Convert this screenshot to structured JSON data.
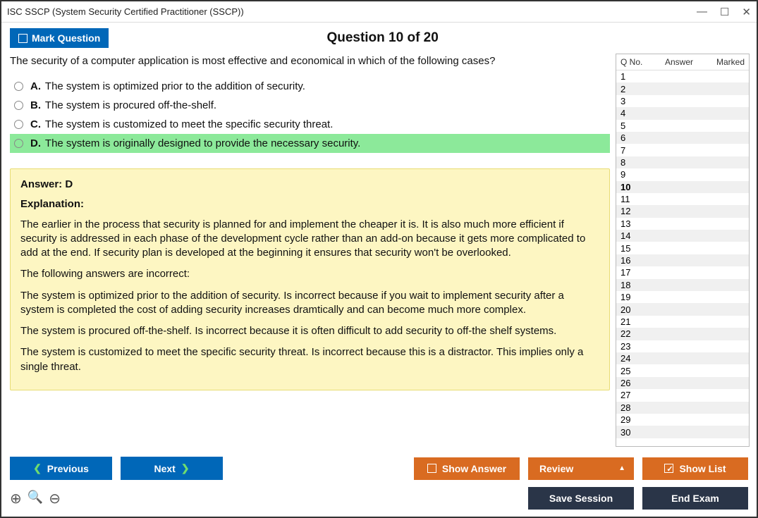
{
  "window_title": "ISC SSCP (System Security Certified Practitioner (SSCP))",
  "mark_label": "Mark Question",
  "question_title": "Question 10 of 20",
  "prompt": "The security of a computer application is most effective and economical in which of the following cases?",
  "options": {
    "A": "The system is optimized prior to the addition of security.",
    "B": "The system is procured off-the-shelf.",
    "C": "The system is customized to meet the specific security threat.",
    "D": "The system is originally designed to provide the necessary security."
  },
  "selected": "D",
  "answer_label": "Answer: D",
  "explanation_label": "Explanation:",
  "explanation": {
    "p1": "The earlier in the process that security is planned for and implement the cheaper it is. It is also much more efficient if security is addressed in each phase of the development cycle rather than an add-on because it gets more complicated to add at the end. If security plan is developed at the beginning it ensures that security won't be overlooked.",
    "p2": "The following answers are incorrect:",
    "p3": "The system is optimized prior to the addition of security. Is incorrect because if you wait to implement security after a system is completed the cost of adding security increases dramtically and can become much more complex.",
    "p4": "The system is procured off-the-shelf. Is incorrect because it is often difficult to add security to off-the shelf systems.",
    "p5": "The system is customized to meet the specific security threat. Is incorrect because this is a distractor. This implies only a single threat."
  },
  "qlist": {
    "h1": "Q No.",
    "h2": "Answer",
    "h3": "Marked",
    "current": 10,
    "total": 30
  },
  "buttons": {
    "prev": "Previous",
    "next": "Next",
    "show_answer": "Show Answer",
    "review": "Review",
    "show_list": "Show List",
    "save_session": "Save Session",
    "end_exam": "End Exam"
  }
}
